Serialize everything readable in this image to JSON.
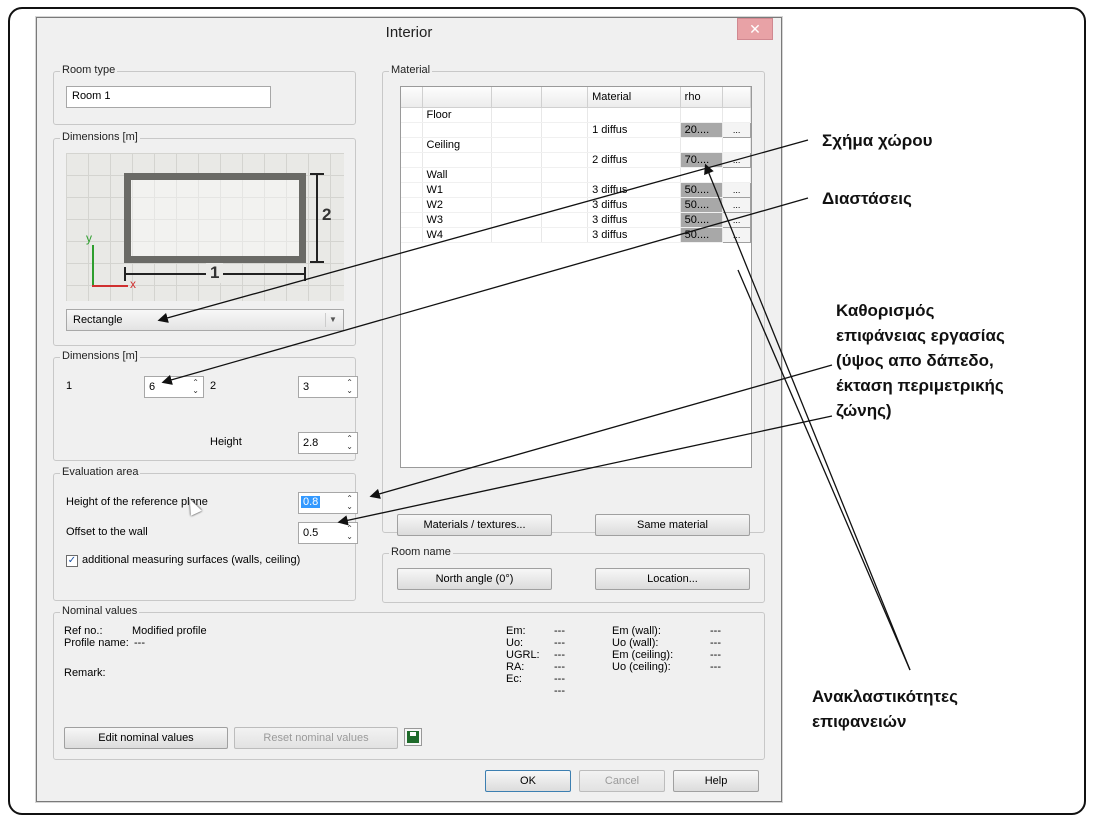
{
  "dialog": {
    "title": "Interior",
    "close": "✕"
  },
  "room_type": {
    "title": "Room type",
    "value": "Room 1"
  },
  "dims_shape": {
    "title": "Dimensions [m]",
    "dim1": "1",
    "dim2": "2",
    "axis_y": "y",
    "axis_x": "x",
    "shape": "Rectangle"
  },
  "dims": {
    "title": "Dimensions [m]",
    "label1": "1",
    "value1": "6",
    "label2": "2",
    "value2": "3",
    "height_label": "Height",
    "height_value": "2.8"
  },
  "evaluation": {
    "title": "Evaluation area",
    "ref_plane_label": "Height of the reference plane",
    "ref_plane_value": "0.8",
    "offset_label": "Offset to the wall",
    "offset_value": "0.5",
    "additional_label": "additional measuring surfaces (walls, ceiling)",
    "additional_checked": true
  },
  "material": {
    "title": "Material",
    "columns": [
      "",
      "",
      "",
      "Material",
      "rho",
      ""
    ],
    "rows": [
      {
        "name": "Floor",
        "material": "",
        "rho": ""
      },
      {
        "name": "",
        "material": "1 diffus",
        "rho": "20...."
      },
      {
        "name": "Ceiling",
        "material": "",
        "rho": ""
      },
      {
        "name": "",
        "material": "2 diffus",
        "rho": "70...."
      },
      {
        "name": "Wall",
        "material": "",
        "rho": ""
      },
      {
        "name": "W1",
        "material": "3 diffus",
        "rho": "50...."
      },
      {
        "name": "W2",
        "material": "3 diffus",
        "rho": "50...."
      },
      {
        "name": "W3",
        "material": "3 diffus",
        "rho": "50...."
      },
      {
        "name": "W4",
        "material": "3 diffus",
        "rho": "50...."
      }
    ],
    "dots": "...",
    "btn_textures": "Materials / textures...",
    "btn_same": "Same material"
  },
  "room_name": {
    "title": "Room name",
    "btn_north": "North angle (0°)",
    "btn_location": "Location..."
  },
  "nominal": {
    "title": "Nominal values",
    "ref_label": "Ref no.:",
    "ref_value": "Modified profile",
    "profile_label": "Profile name:",
    "profile_value": "---",
    "remark_label": "Remark:",
    "col1_labels": [
      "Em:",
      "Uo:",
      "UGRL:",
      "RA:",
      "Ec:",
      ""
    ],
    "col1_values": [
      "---",
      "---",
      "---",
      "---",
      "---",
      "---"
    ],
    "col2_labels": [
      "Em (wall):",
      "Uo (wall):",
      "Em (ceiling):",
      "Uo (ceiling):"
    ],
    "col2_values": [
      "---",
      "---",
      "---",
      "---"
    ],
    "btn_edit": "Edit nominal values",
    "btn_reset": "Reset nominal values"
  },
  "footer": {
    "ok": "OK",
    "cancel": "Cancel",
    "help": "Help"
  },
  "annotations": {
    "shape": "Σχήμα χώρου",
    "dimensions": "Διαστάσεις",
    "work_surface_1": "Καθορισμός",
    "work_surface_2": "επιφάνειας εργασίας",
    "work_surface_3": "(ύψος απο δάπεδο,",
    "work_surface_4": "έκταση περιμετρικής",
    "work_surface_5": "ζώνης)",
    "reflectance_1": "Ανακλαστικότητες",
    "reflectance_2": "επιφανειών"
  }
}
